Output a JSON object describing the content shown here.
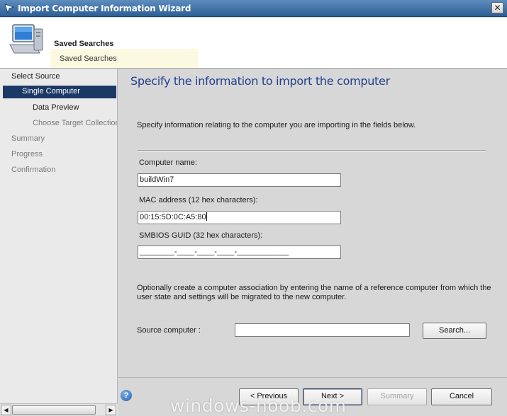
{
  "window": {
    "title": "Import Computer Information Wizard",
    "close_glyph": "✕"
  },
  "header": {
    "title": "Saved Searches",
    "subtitle": "Saved Searches"
  },
  "sidebar": {
    "items": [
      {
        "label": "Select Source"
      },
      {
        "label": "Single Computer"
      },
      {
        "label": "Data Preview"
      },
      {
        "label": "Choose Target Collection"
      },
      {
        "label": "Summary"
      },
      {
        "label": "Progress"
      },
      {
        "label": "Confirmation"
      }
    ]
  },
  "main": {
    "heading": "Specify the information to import the computer",
    "description": "Specify information relating to the computer you are importing in the fields below.",
    "computer_name": {
      "label": "Computer name:",
      "value": "buildWin7"
    },
    "mac": {
      "label": "MAC address (12 hex characters):",
      "value": "00:15:5D:0C:A5:80"
    },
    "guid": {
      "label": "SMBIOS GUID (32 hex characters):",
      "value": "________-____-____-____-____________"
    },
    "association_text": "Optionally create a computer association by entering the name of a reference computer from which the user state and settings will be migrated to the new computer.",
    "source": {
      "label": "Source computer :",
      "value": ""
    },
    "search_label": "Search..."
  },
  "footer": {
    "help_glyph": "?",
    "previous_label": "< Previous",
    "next_label": "Next >",
    "summary_label": "Summary",
    "cancel_label": "Cancel"
  },
  "watermark": "windows-noob.com",
  "colors": {
    "titlebar": "#3a6ea5",
    "nav_selected": "#1c3966",
    "heading": "#1f3e8f"
  }
}
